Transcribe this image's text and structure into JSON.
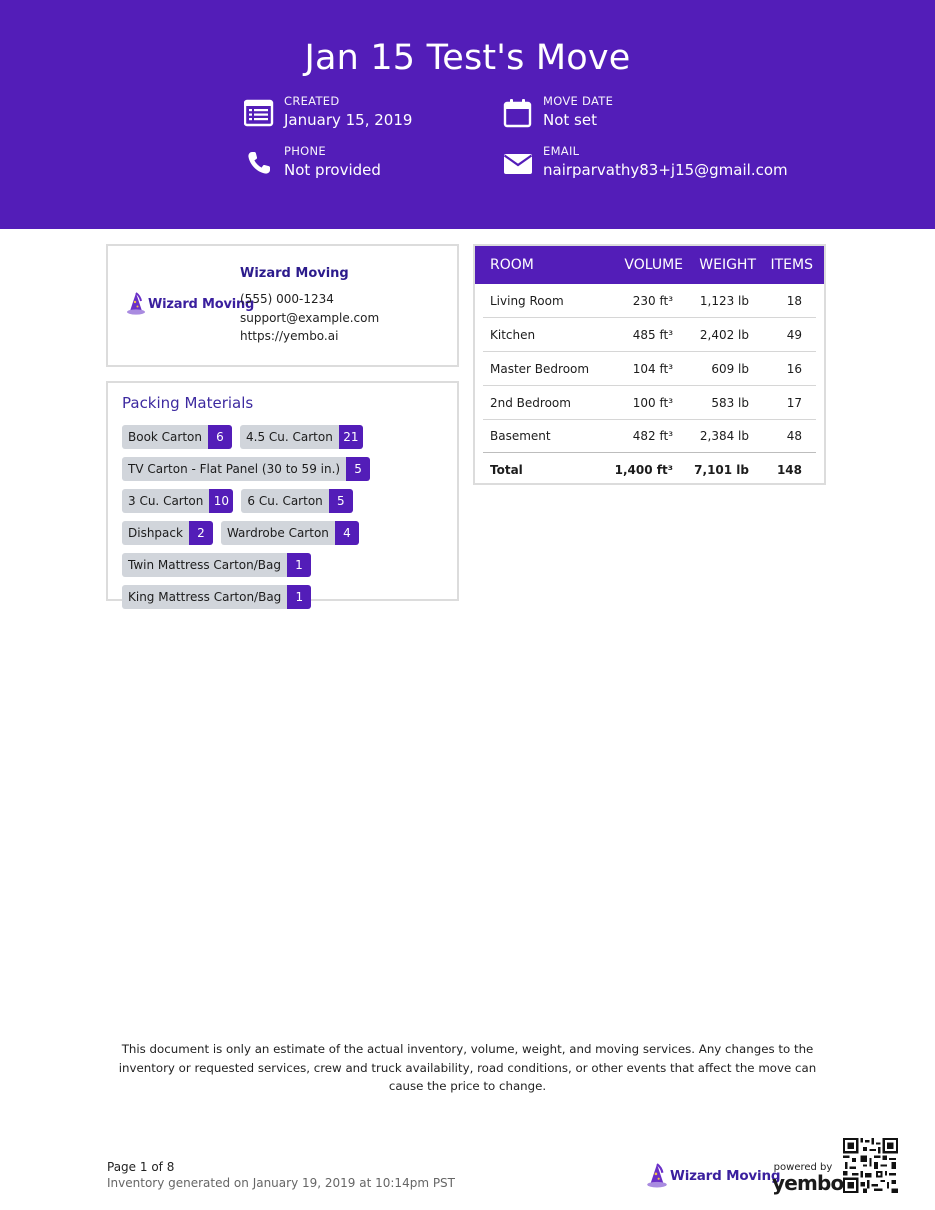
{
  "header": {
    "title": "Jan 15 Test's Move",
    "created_label": "CREATED",
    "created_value": "January 15, 2019",
    "move_date_label": "MOVE DATE",
    "move_date_value": "Not set",
    "phone_label": "PHONE",
    "phone_value": "Not provided",
    "email_label": "EMAIL",
    "email_value": "nairparvathy83+j15@gmail.com"
  },
  "company": {
    "logo_text": "Wizard Moving",
    "name": "Wizard Moving",
    "phone": "(555) 000-1234",
    "email": "support@example.com",
    "website": "https://yembo.ai"
  },
  "packing": {
    "title": "Packing Materials",
    "items": [
      {
        "label": "Book Carton",
        "count": "6"
      },
      {
        "label": "4.5 Cu. Carton",
        "count": "21"
      },
      {
        "label": "TV Carton - Flat Panel (30 to 59 in.)",
        "count": "5"
      },
      {
        "label": "3 Cu. Carton",
        "count": "10"
      },
      {
        "label": "6 Cu. Carton",
        "count": "5"
      },
      {
        "label": "Dishpack",
        "count": "2"
      },
      {
        "label": "Wardrobe Carton",
        "count": "4"
      },
      {
        "label": "Twin Mattress Carton/Bag",
        "count": "1"
      },
      {
        "label": "King Mattress Carton/Bag",
        "count": "1"
      }
    ]
  },
  "rooms": {
    "headers": {
      "room": "ROOM",
      "volume": "VOLUME",
      "weight": "WEIGHT",
      "items": "ITEMS"
    },
    "rows": [
      {
        "room": "Living Room",
        "volume": "230 ft³",
        "weight": "1,123 lb",
        "items": "18"
      },
      {
        "room": "Kitchen",
        "volume": "485 ft³",
        "weight": "2,402 lb",
        "items": "49"
      },
      {
        "room": "Master Bedroom",
        "volume": "104 ft³",
        "weight": "609 lb",
        "items": "16"
      },
      {
        "room": "2nd Bedroom",
        "volume": "100 ft³",
        "weight": "583 lb",
        "items": "17"
      },
      {
        "room": "Basement",
        "volume": "482 ft³",
        "weight": "2,384 lb",
        "items": "48"
      }
    ],
    "total": {
      "room": "Total",
      "volume": "1,400 ft³",
      "weight": "7,101 lb",
      "items": "148"
    }
  },
  "disclaimer": "This document is only an estimate of the actual inventory, volume, weight, and moving services. Any changes to the inventory or requested services, crew and truck availability, road conditions, or other events that affect the move can cause the price to change.",
  "footer": {
    "page": "Page 1 of 8",
    "generated": "Inventory generated on January 19, 2019 at 10:14pm PST",
    "logo_text": "Wizard Moving",
    "powered_by": "powered by",
    "yembo": "yembo"
  },
  "colors": {
    "brand": "#531db8",
    "chip_bg": "#d1d5db",
    "accent_text": "#3d2aa0"
  },
  "icons": [
    "calendar-list-icon",
    "calendar-icon",
    "phone-icon",
    "envelope-icon",
    "wizard-hat-icon",
    "qr-code-icon"
  ]
}
